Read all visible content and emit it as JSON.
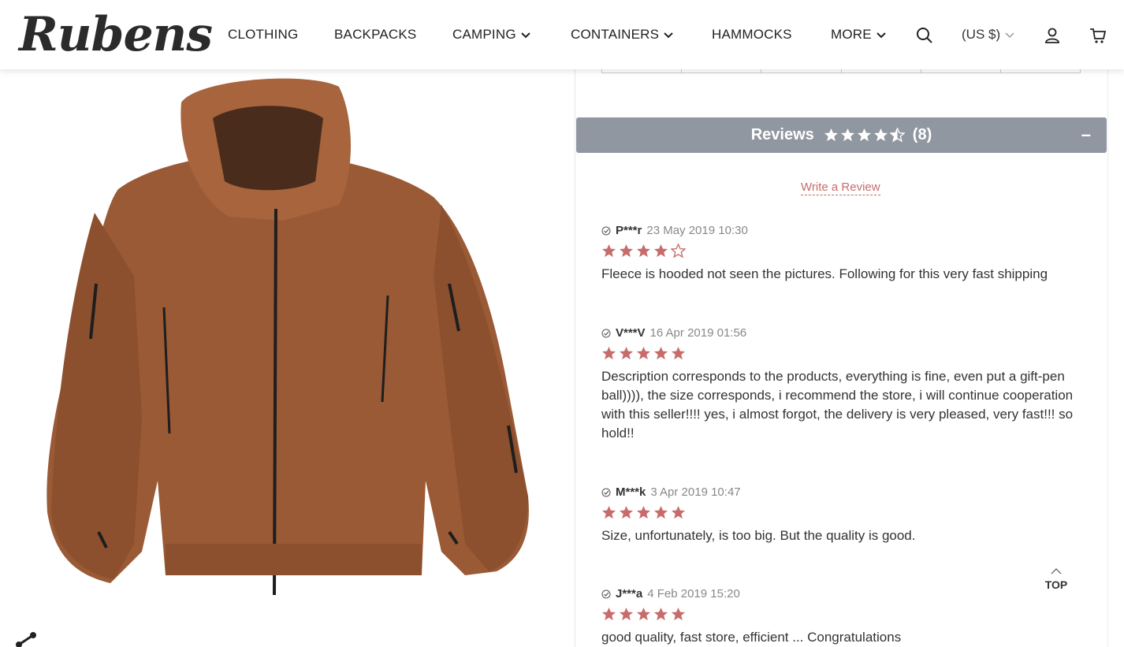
{
  "header": {
    "logo": "Rubens",
    "nav": [
      {
        "label": "CLOTHING"
      },
      {
        "label": "BACKPACKS"
      },
      {
        "label": "CAMPING"
      },
      {
        "label": "CONTAINERS"
      },
      {
        "label": "HAMMOCKS"
      },
      {
        "label": "MORE"
      }
    ],
    "currency": "(US $)",
    "icons": [
      "search-icon",
      "user-icon",
      "cart-icon"
    ]
  },
  "product": {
    "image": "brown fleece hooded jacket",
    "colors": {
      "fleece": "#9a5a35",
      "zipper": "#1e1e1e"
    }
  },
  "reviews": {
    "title": "Reviews",
    "count": "(8)",
    "rating": 4.5,
    "collapse": "–",
    "write_review": "Write a Review",
    "accent": "#c76b6b",
    "items": [
      {
        "name": "P***r",
        "date": "23 May 2019 10:30",
        "stars": 4,
        "text": "Fleece is hooded not seen the pictures. Following for this very fast shipping"
      },
      {
        "name": "V***V",
        "date": "16 Apr 2019 01:56",
        "stars": 5,
        "text": "Description corresponds to the products, everything is fine, even put a gift-pen ball)))), the size corresponds, i recommend the store, i will continue cooperation with this seller!!!! yes, i almost forgot, the delivery is very pleased, very fast!!! so hold!!"
      },
      {
        "name": "M***k",
        "date": "3 Apr 2019 10:47",
        "stars": 5,
        "text": "Size, unfortunately, is too big. But the quality is good."
      },
      {
        "name": "J***a",
        "date": "4 Feb 2019 15:20",
        "stars": 5,
        "text": "good quality, fast store, efficient ... Congratulations"
      }
    ]
  },
  "top_button": "TOP"
}
